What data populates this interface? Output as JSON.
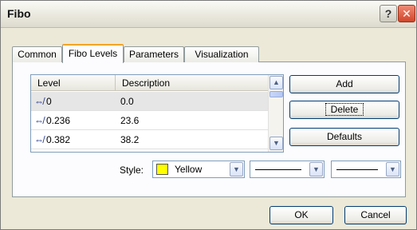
{
  "window": {
    "title": "Fibo",
    "help_glyph": "?",
    "close_glyph": "✕"
  },
  "tabs": [
    {
      "label": "Common"
    },
    {
      "label": "Fibo Levels",
      "active": true
    },
    {
      "label": "Parameters"
    },
    {
      "label": "Visualization"
    }
  ],
  "levels_table": {
    "columns": [
      "Level",
      "Description"
    ],
    "rows": [
      {
        "level": "0",
        "description": "0.0",
        "selected": true
      },
      {
        "level": "0.236",
        "description": "23.6"
      },
      {
        "level": "0.382",
        "description": "38.2"
      }
    ],
    "row_icon": "level-line-icon"
  },
  "side_buttons": {
    "add": "Add",
    "delete": "Delete",
    "defaults": "Defaults"
  },
  "style_row": {
    "label": "Style:",
    "color_name": "Yellow",
    "color_value": "#ffff00",
    "line_style_icon": "solid-line-icon",
    "line_width_icon": "line-width-icon"
  },
  "footer": {
    "ok": "OK",
    "cancel": "Cancel"
  },
  "colors": {
    "tab_accent": "#f4a326",
    "button_border": "#003c74",
    "panel_bg": "#ece9d8"
  }
}
